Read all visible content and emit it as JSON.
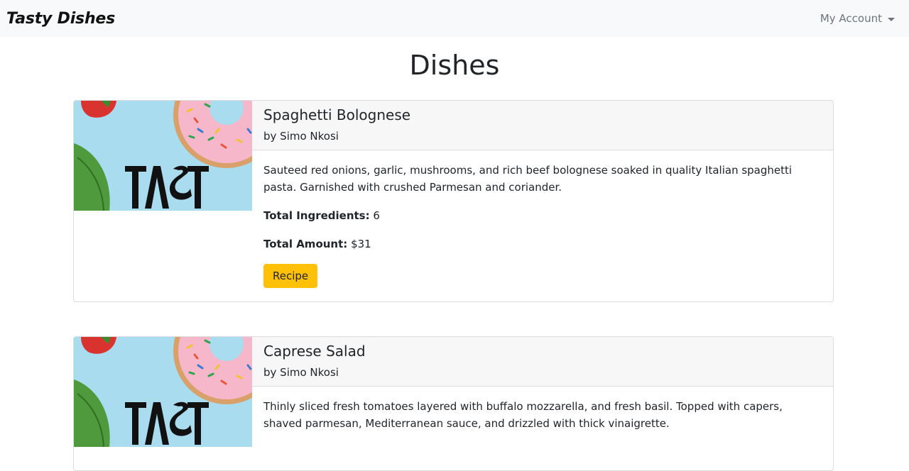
{
  "navbar": {
    "brand": "Tasty Dishes",
    "account_label": "My Account"
  },
  "page_title": "Dishes",
  "image_logo_text": "TASTY",
  "dishes": [
    {
      "title": "Spaghetti Bolognese",
      "author": "by Simo Nkosi",
      "description": "Sauteed red onions, garlic, mushrooms, and rich beef bolognese soaked in quality Italian spaghetti pasta. Garnished with crushed Parmesan and coriander.",
      "ingredients_label": "Total Ingredients:",
      "ingredients_value": "6",
      "amount_label": "Total Amount:",
      "amount_value": "$31",
      "button_label": "Recipe"
    },
    {
      "title": "Caprese Salad",
      "author": "by Simo Nkosi",
      "description": "Thinly sliced fresh tomatoes layered with buffalo mozzarella, and fresh basil. Topped with capers, shaved parmesan, Mediterranean sauce, and drizzled with thick vinaigrette."
    }
  ],
  "colors": {
    "navbar_bg": "#f8f9fa",
    "button": "#ffc107",
    "image_bg": "#a9dcef"
  }
}
